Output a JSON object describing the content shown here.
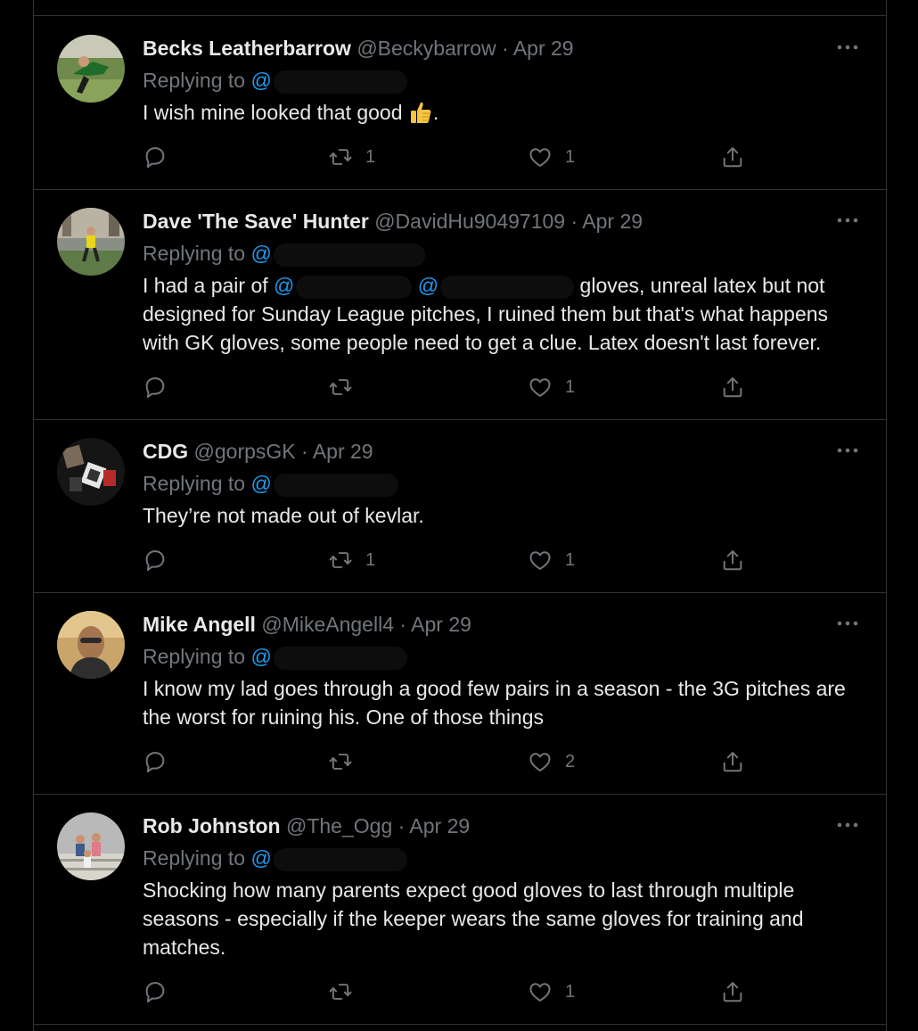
{
  "colors": {
    "background": "#000000",
    "text": "#e7e9ea",
    "muted": "#71767b",
    "accent": "#1d9bf0",
    "divider": "#2f3336"
  },
  "icons": {
    "reply": "speech-bubble-icon",
    "retweet": "retweet-arrows-icon",
    "like": "heart-icon",
    "share": "share-upload-icon",
    "more": "ellipsis-icon"
  },
  "reply_prefix": "Replying to",
  "tweets": [
    {
      "name": "Becks Leatherbarrow",
      "handle": "@Beckybarrow",
      "dot": "·",
      "date": "Apr 29",
      "mention": "@",
      "text_before": "I wish mine looked that good",
      "emoji": "thumbs-up",
      "text_after": ".",
      "retweets": "1",
      "likes": "1"
    },
    {
      "name": "Dave 'The Save' Hunter",
      "handle": "@DavidHu90497109",
      "dot": "·",
      "date": "Apr 29",
      "mention": "@",
      "text_m1": "I had a pair of",
      "mention2": "@",
      "mention3": "@",
      "text": "gloves, unreal latex but not designed for Sunday League pitches, I ruined them but that's what happens with GK gloves, some people need to get a clue. Latex doesn't last forever.",
      "retweets": "",
      "likes": "1"
    },
    {
      "name": "CDG",
      "handle": "@gorpsGK",
      "dot": "·",
      "date": "Apr 29",
      "mention": "@",
      "text": "They’re not made out of kevlar.",
      "retweets": "1",
      "likes": "1"
    },
    {
      "name": "Mike Angell",
      "handle": "@MikeAngell4",
      "dot": "·",
      "date": "Apr 29",
      "mention": "@",
      "text": "I know my lad goes through a good few pairs in a season - the 3G pitches are the worst for ruining his. One of those things",
      "retweets": "",
      "likes": "2"
    },
    {
      "name": "Rob Johnston",
      "handle": "@The_Ogg",
      "dot": "·",
      "date": "Apr 29",
      "mention": "@",
      "text": "Shocking how many parents expect good gloves to last through multiple seasons - especially if the keeper wears the same gloves for training and matches.",
      "retweets": "",
      "likes": "1"
    }
  ]
}
